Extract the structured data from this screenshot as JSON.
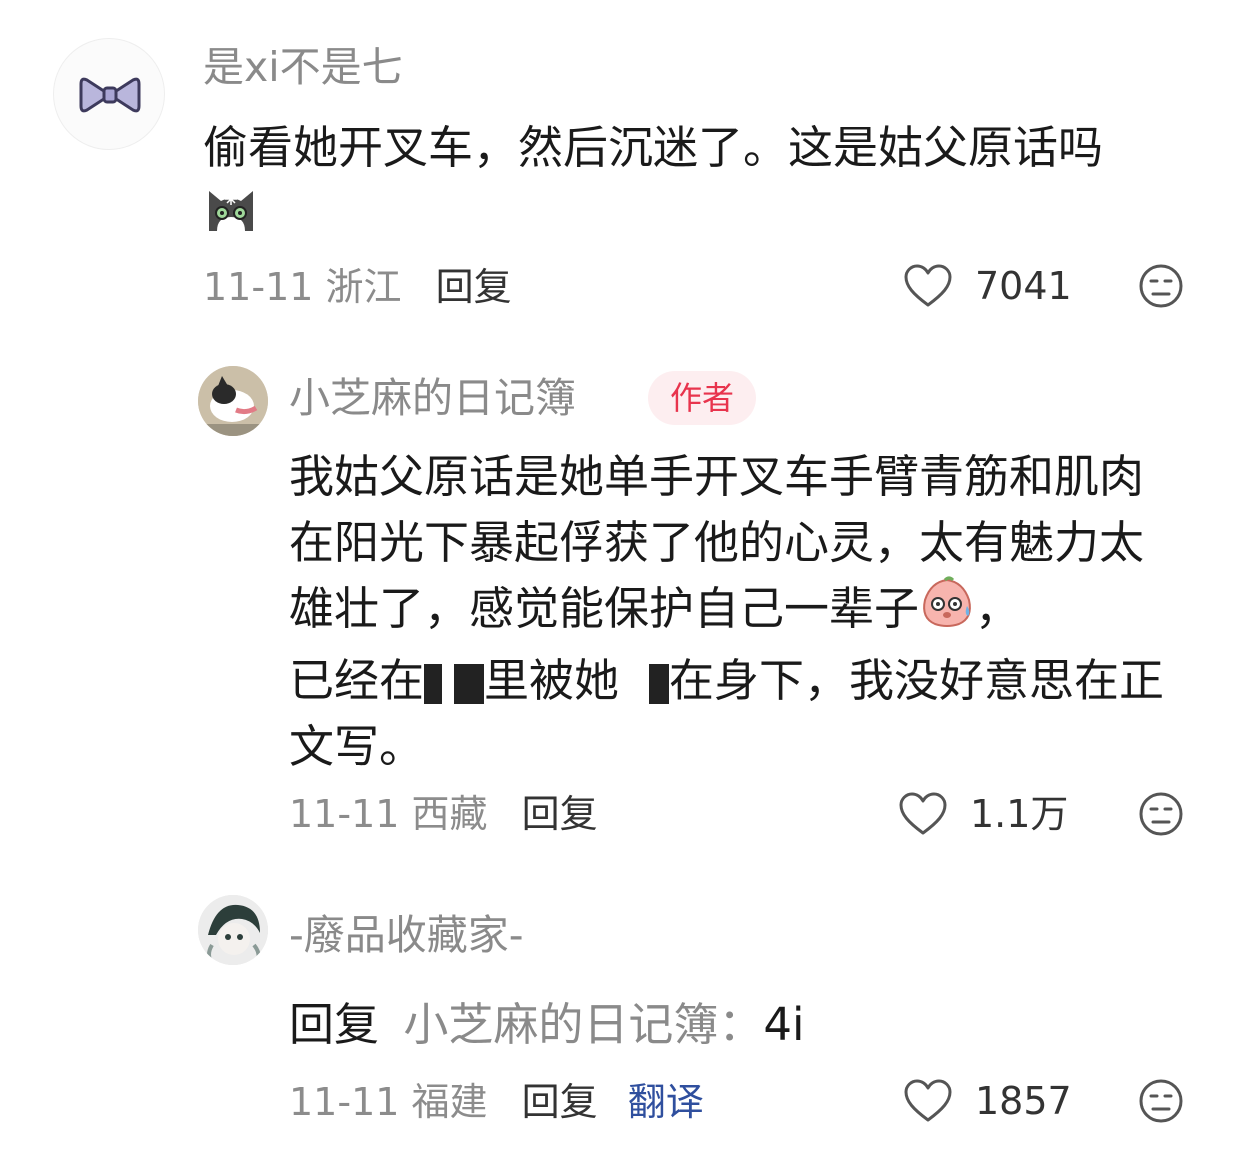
{
  "colors": {
    "author_badge_bg": "#fdeef0",
    "author_badge_text": "#e8344d",
    "translate": "#2f4f9e",
    "meta": "#8c8c8c"
  },
  "comments": [
    {
      "username": "是xi不是七",
      "avatar_icon": "bow-tie-icon",
      "text": "偷看她开叉车，然后沉迷了。这是姑父原话吗",
      "emoji": "cat-face-emoji",
      "date": "11-11",
      "location": "浙江",
      "reply_label": "回复",
      "likes": "7041"
    },
    {
      "username": "小芝麻的日记簿",
      "avatar_icon": "dog-photo-avatar",
      "badge": "作者",
      "text_part1": "我姑父原话是她单手开叉车手臂青筋和肌肉在阳光下暴起俘获了他的心灵，太有魅力太雄壮了，感觉能保护自己一辈子",
      "emoji": "embarrassed-peach-emoji",
      "text_part2": "，",
      "text_part3a": "已经在",
      "text_part3b": "里被她",
      "text_part3c": "在身下，我没好意思在正文写。",
      "date": "11-11",
      "location": "西藏",
      "reply_label": "回复",
      "likes": "1.1万"
    },
    {
      "username": "-廢品收藏家-",
      "avatar_icon": "anime-character-avatar",
      "reply_prefix": "回复",
      "reply_target": "小芝麻的日记簿：",
      "reply_text": "4i",
      "date": "11-11",
      "location": "福建",
      "reply_label": "回复",
      "translate_label": "翻译",
      "likes": "1857"
    }
  ]
}
